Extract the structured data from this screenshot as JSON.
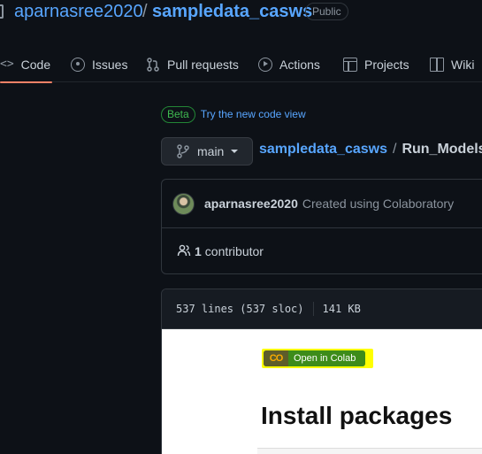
{
  "repo": {
    "owner": "aparnasree2020",
    "separator": "/",
    "name": "sampledata_casws",
    "visibility": "Public"
  },
  "tabs": [
    {
      "label": "Code",
      "icon": "code-icon",
      "selected": true
    },
    {
      "label": "Issues",
      "icon": "issue-icon"
    },
    {
      "label": "Pull requests",
      "icon": "pull-request-icon"
    },
    {
      "label": "Actions",
      "icon": "play-icon"
    },
    {
      "label": "Projects",
      "icon": "table-icon"
    },
    {
      "label": "Wiki",
      "icon": "book-icon"
    }
  ],
  "beta": {
    "badge": "Beta",
    "link": "Try the new code view"
  },
  "branch": {
    "name": "main",
    "icon": "git-branch-icon"
  },
  "breadcrumb": {
    "repo": "sampledata_casws",
    "separator": "/",
    "file": "Run_Models_c"
  },
  "commit": {
    "author": "aparnasree2020",
    "message": "Created using Colaboratory"
  },
  "contributors": {
    "count": "1",
    "label": "contributor",
    "icon": "people-icon"
  },
  "file_info": {
    "lines": "537 lines (537 sloc)",
    "size": "141 KB"
  },
  "notebook": {
    "colab_logo": "CO",
    "colab_button": "Open in Colab",
    "heading": "Install packages"
  },
  "colors": {
    "background": "#0d1117",
    "link": "#58a6ff",
    "selected_tab_underline": "#f78166",
    "beta_green": "#3fb950",
    "colab_highlight": "#ffff00"
  }
}
